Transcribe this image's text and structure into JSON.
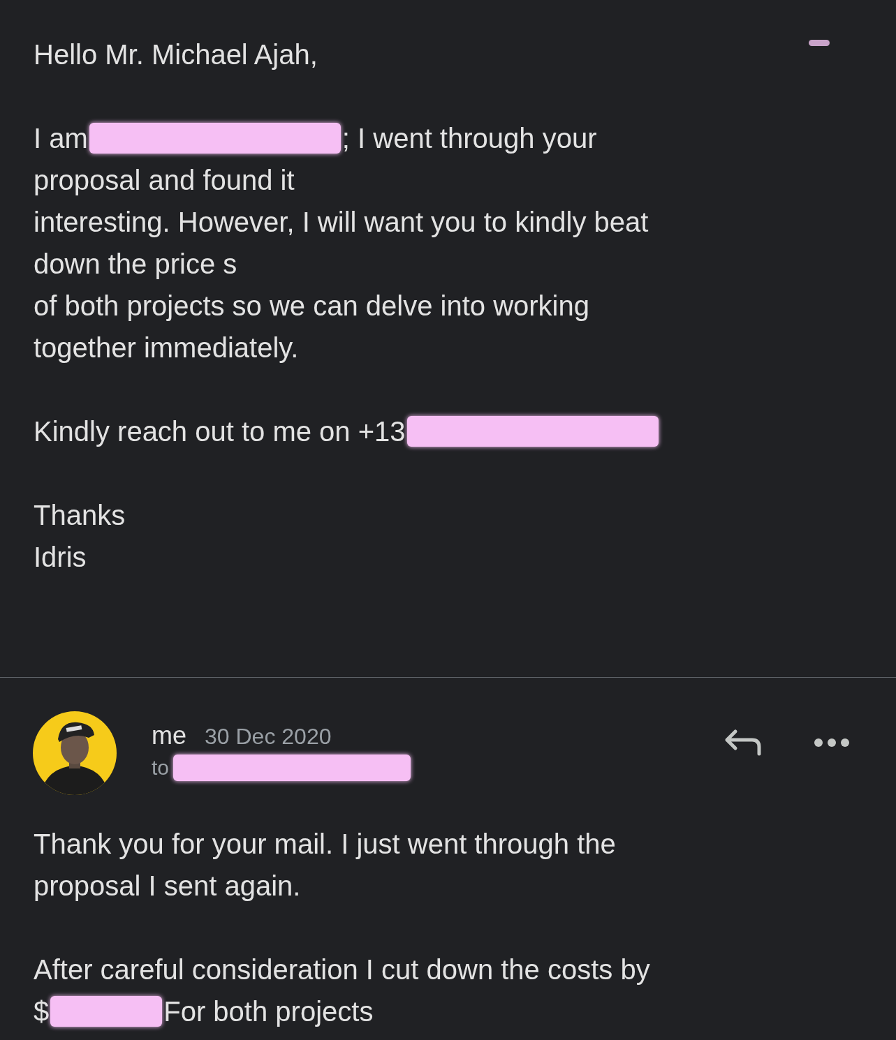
{
  "first_message": {
    "paragraphs": [
      [
        [
          {
            "kind": "text",
            "text": "Hello Mr. Michael Ajah,"
          }
        ]
      ],
      [
        [
          {
            "kind": "text",
            "text": "I am"
          },
          {
            "kind": "redaction"
          },
          {
            "kind": "text",
            "text": "; I went through your"
          }
        ],
        [
          {
            "kind": "text",
            "text": "proposal and found it"
          }
        ],
        [
          {
            "kind": "text",
            "text": "interesting. However, I will want you to kindly beat"
          }
        ],
        [
          {
            "kind": "text",
            "text": "down the price s"
          }
        ],
        [
          {
            "kind": "text",
            "text": "of both projects so we can delve into working"
          }
        ],
        [
          {
            "kind": "text",
            "text": "together immediately."
          }
        ]
      ],
      [
        [
          {
            "kind": "text",
            "text": "Kindly reach out to me on +13"
          },
          {
            "kind": "redaction"
          }
        ]
      ],
      [
        [
          {
            "kind": "text",
            "text": "Thanks"
          }
        ],
        [
          {
            "kind": "text",
            "text": "Idris"
          }
        ]
      ]
    ]
  },
  "reply": {
    "sender": "me",
    "date": "30 Dec 2020",
    "recipient_label": "to",
    "avatar": {
      "kind": "picture"
    },
    "paragraphs": [
      [
        [
          {
            "kind": "text",
            "text": "Thank you for your mail. I just went through the"
          }
        ],
        [
          {
            "kind": "text",
            "text": "proposal I sent again."
          }
        ]
      ],
      [
        [
          {
            "kind": "text",
            "text": "After careful consideration I cut down the costs by"
          }
        ],
        [
          {
            "kind": "text",
            "text": "$"
          },
          {
            "kind": "redaction"
          },
          {
            "kind": "text",
            "text": "For both projects"
          }
        ]
      ]
    ]
  }
}
